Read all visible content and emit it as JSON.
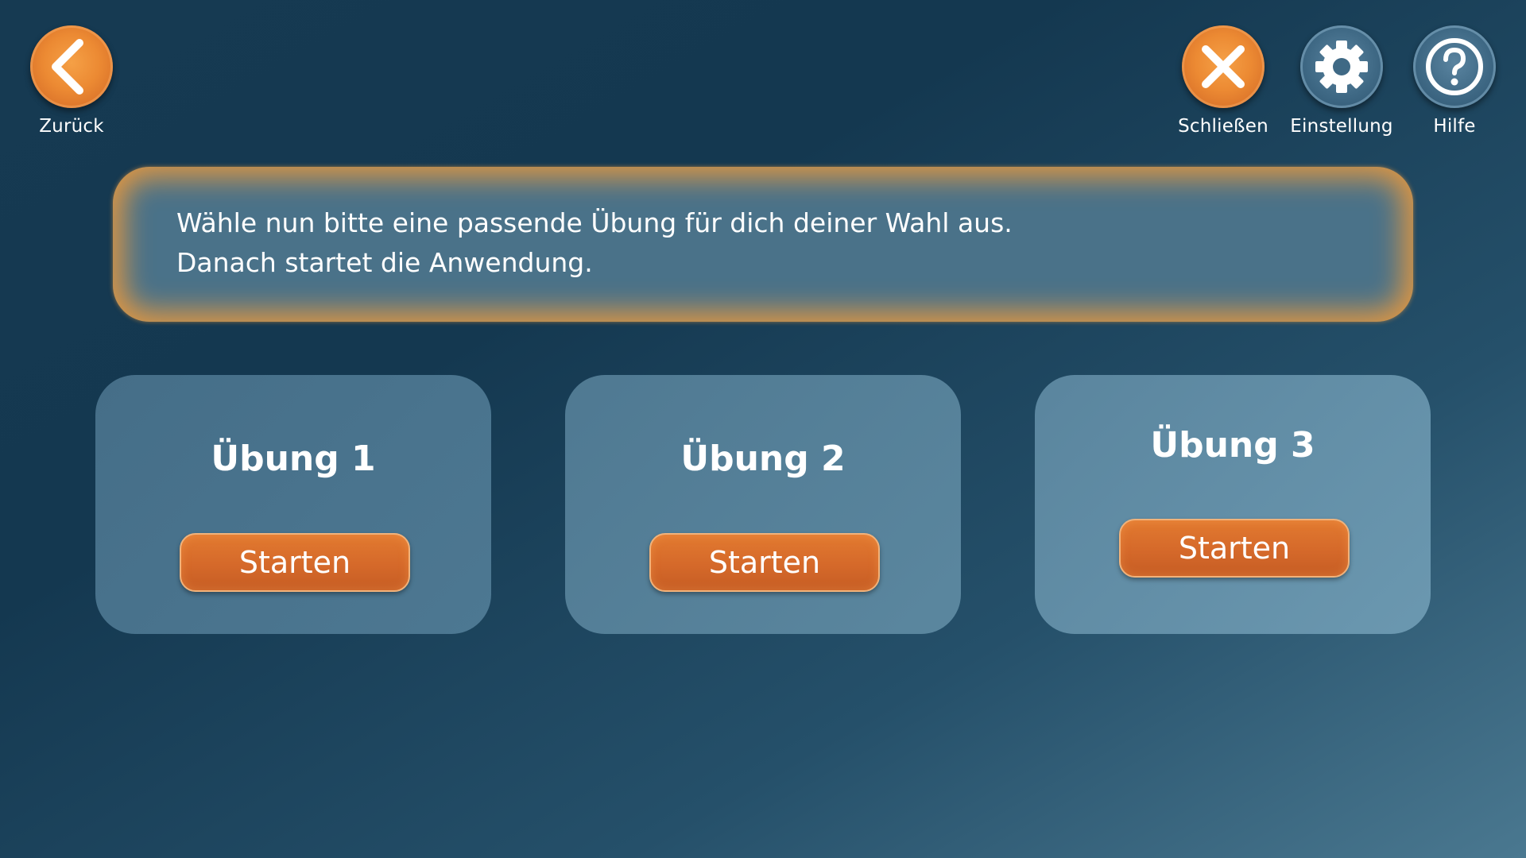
{
  "toolbar": {
    "back_label": "Zurück",
    "close_label": "Schließen",
    "settings_label": "Einstellung",
    "help_label": "Hilfe"
  },
  "icons": {
    "back": "chevron-left-icon",
    "close": "close-icon",
    "settings": "gear-icon",
    "help": "question-mark-icon"
  },
  "colors": {
    "accent_orange": "#e27a30",
    "banner_glow": "#e49840",
    "background_dark": "#143850"
  },
  "instruction": {
    "line1": "Wähle nun bitte eine passende Übung für dich deiner Wahl aus.",
    "line2": "Danach startet die Anwendung."
  },
  "exercises": [
    {
      "title": "Übung 1",
      "button_label": "Starten"
    },
    {
      "title": "Übung 2",
      "button_label": "Starten"
    },
    {
      "title": "Übung 3",
      "button_label": "Starten"
    }
  ]
}
